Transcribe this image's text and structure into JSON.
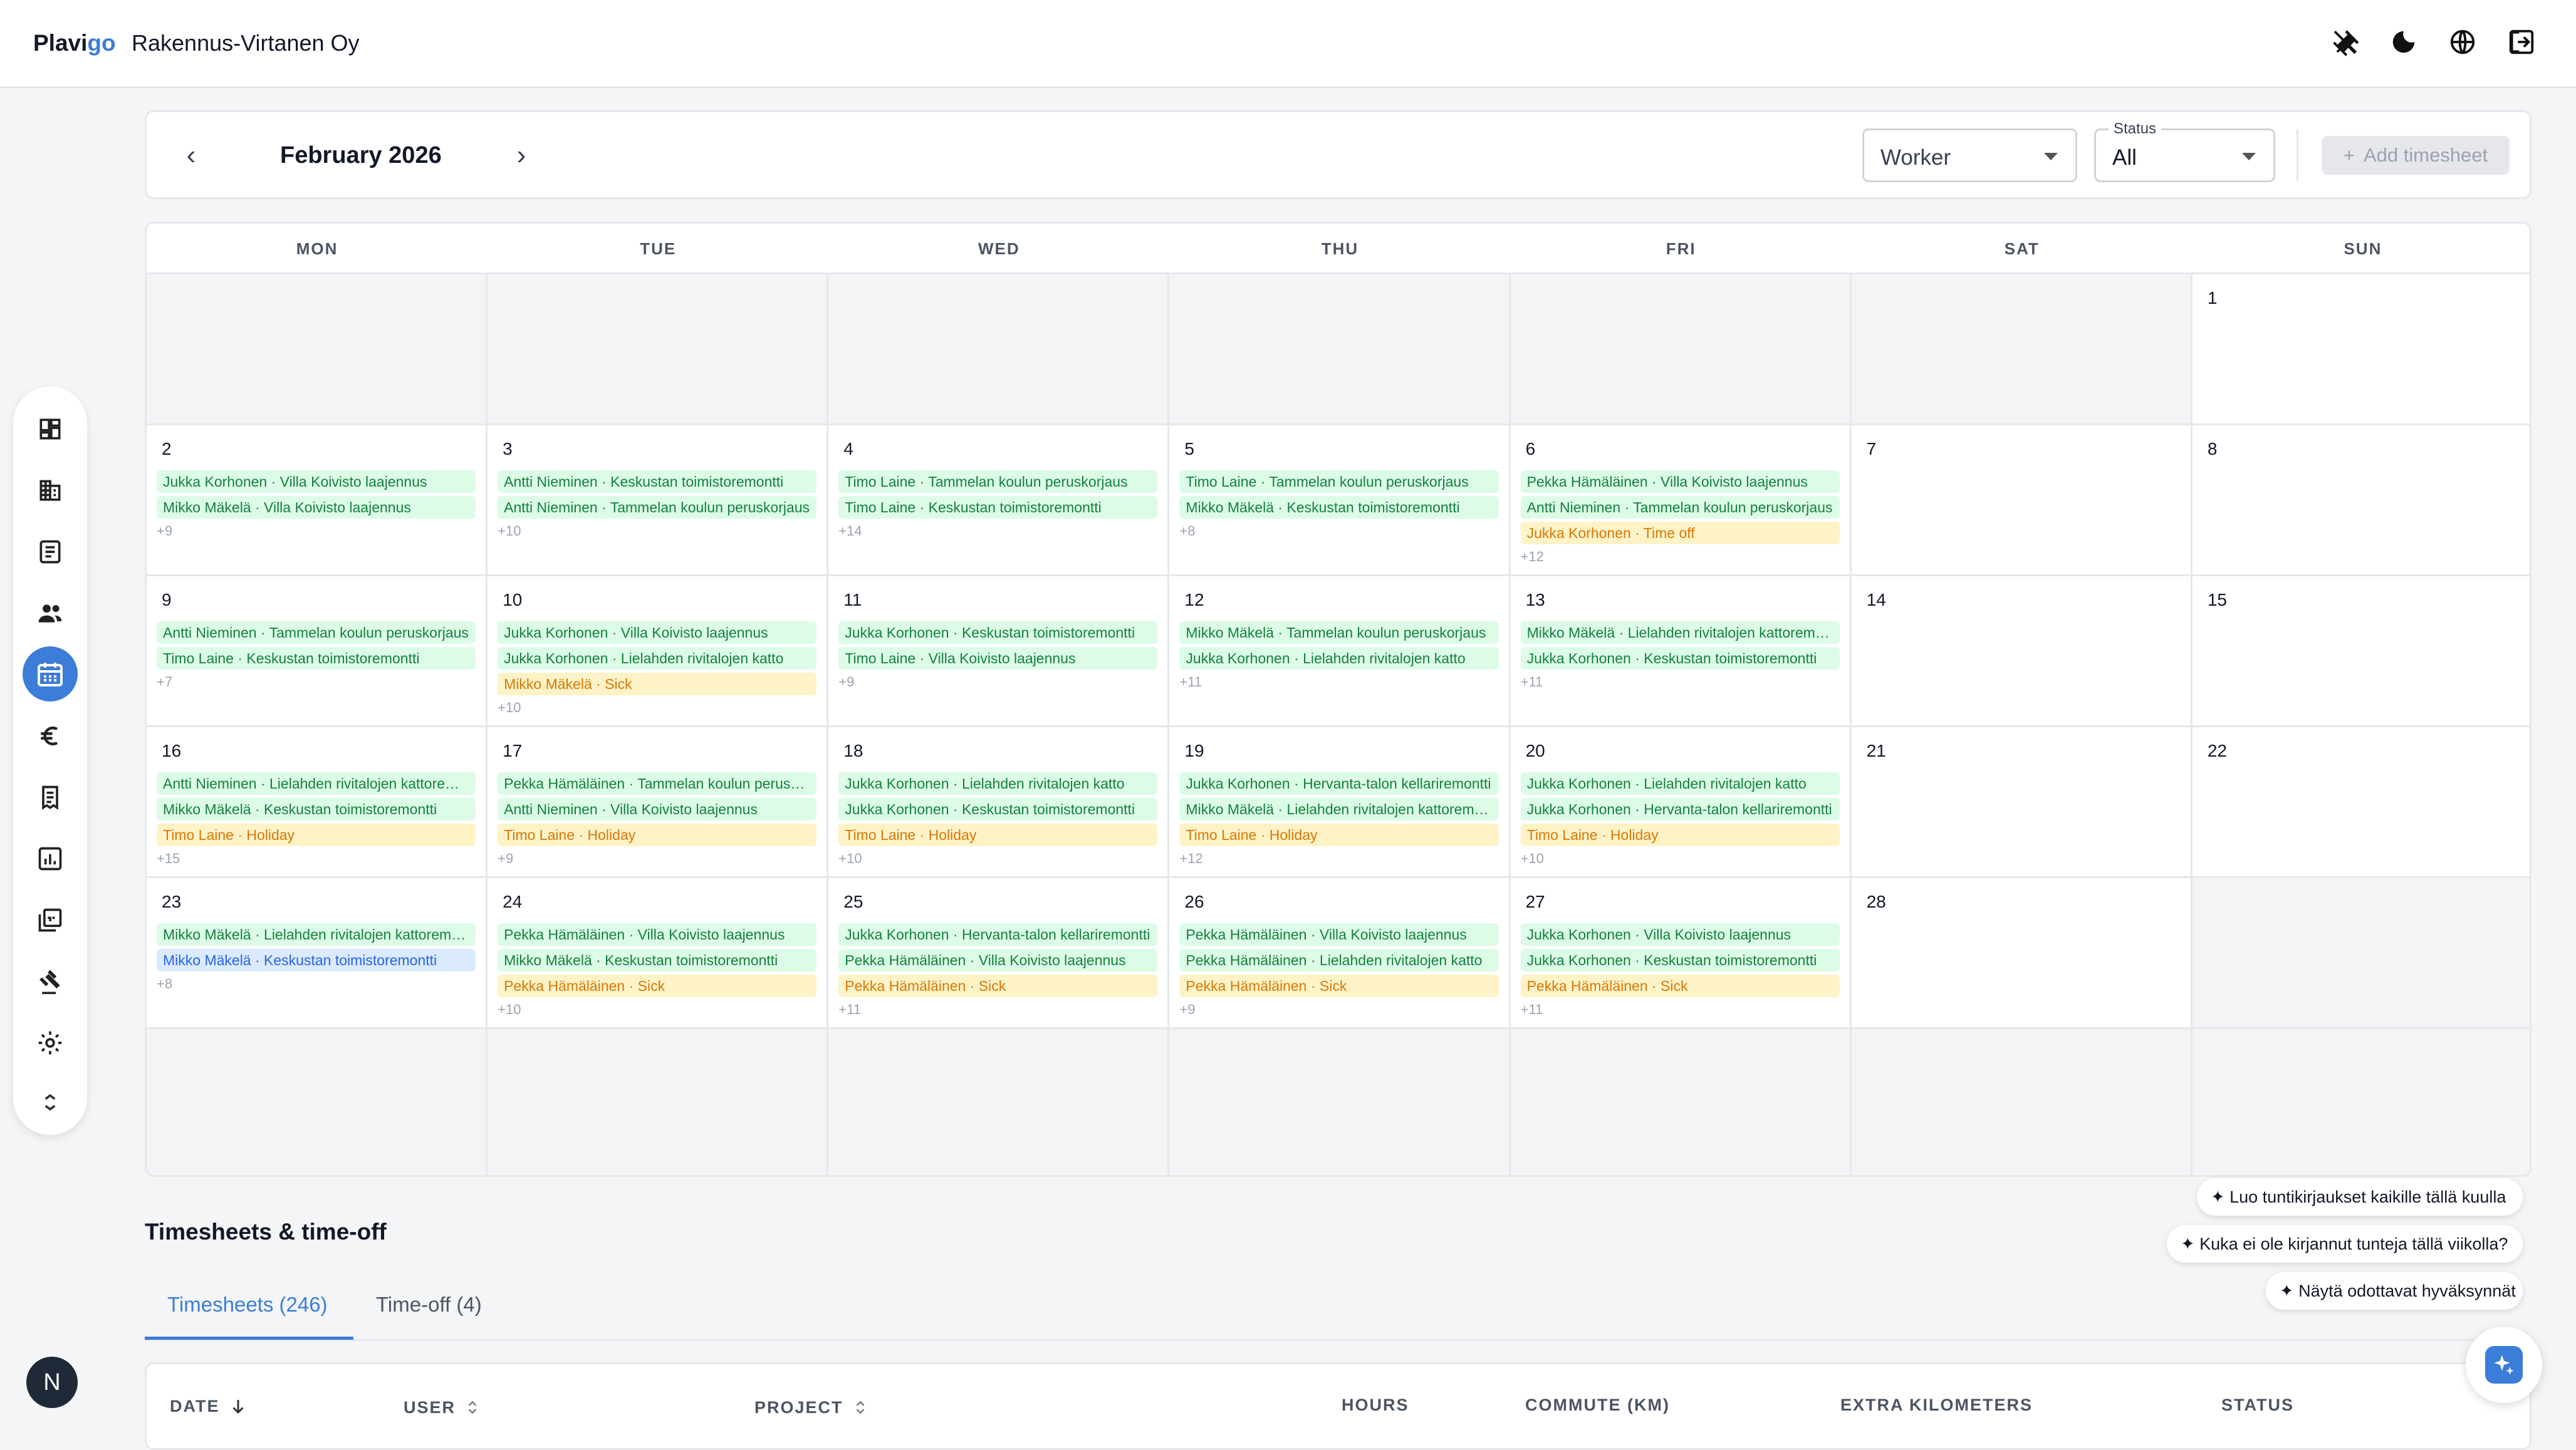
{
  "app": {
    "brand_main": "Plavi",
    "brand_accent": "go",
    "company": "Rakennus-Virtanen Oy",
    "accent_color": "#3b7dd8"
  },
  "top_icons": [
    "tools-icon",
    "dark-mode-icon",
    "language-globe-icon",
    "logout-icon"
  ],
  "sidebar": {
    "items": [
      {
        "icon": "dashboard-icon"
      },
      {
        "icon": "company-building-icon"
      },
      {
        "icon": "projects-document-icon"
      },
      {
        "icon": "users-icon"
      },
      {
        "icon": "calendar-icon",
        "active": true
      },
      {
        "icon": "euro-icon"
      },
      {
        "icon": "invoice-receipt-icon"
      },
      {
        "icon": "reports-chart-icon"
      },
      {
        "icon": "pdf-document-icon"
      },
      {
        "icon": "legal-gavel-icon"
      },
      {
        "icon": "settings-gear-icon"
      },
      {
        "icon": "collapse-chevrons-icon"
      }
    ],
    "avatar_initial": "N"
  },
  "calendar": {
    "prev_icon": "‹",
    "next_icon": "›",
    "month_label": "February 2026",
    "worker_filter": {
      "value": "Worker"
    },
    "status_filter": {
      "label": "Status",
      "value": "All"
    },
    "add_button": "Add timesheet",
    "add_icon": "+",
    "weekdays": [
      "MON",
      "TUE",
      "WED",
      "THU",
      "FRI",
      "SAT",
      "SUN"
    ],
    "weeks": [
      [
        {
          "day": "",
          "entries": [],
          "more": ""
        },
        {
          "day": "",
          "entries": [],
          "more": ""
        },
        {
          "day": "",
          "entries": [],
          "more": ""
        },
        {
          "day": "",
          "entries": [],
          "more": ""
        },
        {
          "day": "",
          "entries": [],
          "more": ""
        },
        {
          "day": "",
          "entries": [],
          "more": ""
        },
        {
          "day": "1",
          "entries": [],
          "more": ""
        }
      ],
      [
        {
          "day": "2",
          "entries": [
            {
              "text": "Jukka Korhonen · Villa Koivisto laajennus",
              "color": "green"
            },
            {
              "text": "Mikko Mäkelä · Villa Koivisto laajennus",
              "color": "green"
            }
          ],
          "more": "+9"
        },
        {
          "day": "3",
          "entries": [
            {
              "text": "Antti Nieminen · Keskustan toimistoremontti",
              "color": "green"
            },
            {
              "text": "Antti Nieminen · Tammelan koulun peruskorjaus",
              "color": "green"
            }
          ],
          "more": "+10"
        },
        {
          "day": "4",
          "entries": [
            {
              "text": "Timo Laine · Tammelan koulun peruskorjaus",
              "color": "green"
            },
            {
              "text": "Timo Laine · Keskustan toimistoremontti",
              "color": "green"
            }
          ],
          "more": "+14"
        },
        {
          "day": "5",
          "entries": [
            {
              "text": "Timo Laine · Tammelan koulun peruskorjaus",
              "color": "green"
            },
            {
              "text": "Mikko Mäkelä · Keskustan toimistoremontti",
              "color": "green"
            }
          ],
          "more": "+8"
        },
        {
          "day": "6",
          "entries": [
            {
              "text": "Pekka Hämäläinen · Villa Koivisto laajennus",
              "color": "green"
            },
            {
              "text": "Antti Nieminen · Tammelan koulun peruskorjaus",
              "color": "green"
            },
            {
              "text": "Jukka Korhonen · Time off",
              "color": "yellow"
            }
          ],
          "more": "+12"
        },
        {
          "day": "7",
          "entries": [],
          "more": ""
        },
        {
          "day": "8",
          "entries": [],
          "more": ""
        }
      ],
      [
        {
          "day": "9",
          "entries": [
            {
              "text": "Antti Nieminen · Tammelan koulun peruskorjaus",
              "color": "green"
            },
            {
              "text": "Timo Laine · Keskustan toimistoremontti",
              "color": "green"
            }
          ],
          "more": "+7"
        },
        {
          "day": "10",
          "entries": [
            {
              "text": "Jukka Korhonen · Villa Koivisto laajennus",
              "color": "green"
            },
            {
              "text": "Jukka Korhonen · Lielahden rivitalojen katto",
              "color": "green"
            },
            {
              "text": "Mikko Mäkelä · Sick",
              "color": "yellow"
            }
          ],
          "more": "+10"
        },
        {
          "day": "11",
          "entries": [
            {
              "text": "Jukka Korhonen · Keskustan toimistoremontti",
              "color": "green"
            },
            {
              "text": "Timo Laine · Villa Koivisto laajennus",
              "color": "green"
            }
          ],
          "more": "+9"
        },
        {
          "day": "12",
          "entries": [
            {
              "text": "Mikko Mäkelä · Tammelan koulun peruskorjaus",
              "color": "green"
            },
            {
              "text": "Jukka Korhonen · Lielahden rivitalojen katto",
              "color": "green"
            }
          ],
          "more": "+11"
        },
        {
          "day": "13",
          "entries": [
            {
              "text": "Mikko Mäkelä · Lielahden rivitalojen kattoremontti",
              "color": "green"
            },
            {
              "text": "Jukka Korhonen · Keskustan toimistoremontti",
              "color": "green"
            }
          ],
          "more": "+11"
        },
        {
          "day": "14",
          "entries": [],
          "more": ""
        },
        {
          "day": "15",
          "entries": [],
          "more": ""
        }
      ],
      [
        {
          "day": "16",
          "entries": [
            {
              "text": "Antti Nieminen · Lielahden rivitalojen kattoremontti",
              "color": "green"
            },
            {
              "text": "Mikko Mäkelä · Keskustan toimistoremontti",
              "color": "green"
            },
            {
              "text": "Timo Laine · Holiday",
              "color": "yellow"
            }
          ],
          "more": "+15"
        },
        {
          "day": "17",
          "entries": [
            {
              "text": "Pekka Hämäläinen · Tammelan koulun peruskorjaus",
              "color": "green"
            },
            {
              "text": "Antti Nieminen · Villa Koivisto laajennus",
              "color": "green"
            },
            {
              "text": "Timo Laine · Holiday",
              "color": "yellow"
            }
          ],
          "more": "+9"
        },
        {
          "day": "18",
          "entries": [
            {
              "text": "Jukka Korhonen · Lielahden rivitalojen katto",
              "color": "green"
            },
            {
              "text": "Jukka Korhonen · Keskustan toimistoremontti",
              "color": "green"
            },
            {
              "text": "Timo Laine · Holiday",
              "color": "yellow"
            }
          ],
          "more": "+10"
        },
        {
          "day": "19",
          "entries": [
            {
              "text": "Jukka Korhonen · Hervanta-talon kellariremontti",
              "color": "green"
            },
            {
              "text": "Mikko Mäkelä · Lielahden rivitalojen kattoremontti",
              "color": "green"
            },
            {
              "text": "Timo Laine · Holiday",
              "color": "yellow"
            }
          ],
          "more": "+12"
        },
        {
          "day": "20",
          "entries": [
            {
              "text": "Jukka Korhonen · Lielahden rivitalojen katto",
              "color": "green"
            },
            {
              "text": "Jukka Korhonen · Hervanta-talon kellariremontti",
              "color": "green"
            },
            {
              "text": "Timo Laine · Holiday",
              "color": "yellow"
            }
          ],
          "more": "+10"
        },
        {
          "day": "21",
          "entries": [],
          "more": ""
        },
        {
          "day": "22",
          "entries": [],
          "more": ""
        }
      ],
      [
        {
          "day": "23",
          "entries": [
            {
              "text": "Mikko Mäkelä · Lielahden rivitalojen kattoremontti",
              "color": "green"
            },
            {
              "text": "Mikko Mäkelä · Keskustan toimistoremontti",
              "color": "blue"
            }
          ],
          "more": "+8"
        },
        {
          "day": "24",
          "entries": [
            {
              "text": "Pekka Hämäläinen · Villa Koivisto laajennus",
              "color": "green"
            },
            {
              "text": "Mikko Mäkelä · Keskustan toimistoremontti",
              "color": "green"
            },
            {
              "text": "Pekka Hämäläinen · Sick",
              "color": "yellow"
            }
          ],
          "more": "+10"
        },
        {
          "day": "25",
          "entries": [
            {
              "text": "Jukka Korhonen · Hervanta-talon kellariremontti",
              "color": "green"
            },
            {
              "text": "Pekka Hämäläinen · Villa Koivisto laajennus",
              "color": "green"
            },
            {
              "text": "Pekka Hämäläinen · Sick",
              "color": "yellow"
            }
          ],
          "more": "+11"
        },
        {
          "day": "26",
          "entries": [
            {
              "text": "Pekka Hämäläinen · Villa Koivisto laajennus",
              "color": "green"
            },
            {
              "text": "Pekka Hämäläinen · Lielahden rivitalojen katto",
              "color": "green"
            },
            {
              "text": "Pekka Hämäläinen · Sick",
              "color": "yellow"
            }
          ],
          "more": "+9"
        },
        {
          "day": "27",
          "entries": [
            {
              "text": "Jukka Korhonen · Villa Koivisto laajennus",
              "color": "green"
            },
            {
              "text": "Jukka Korhonen · Keskustan toimistoremontti",
              "color": "green"
            },
            {
              "text": "Pekka Hämäläinen · Sick",
              "color": "yellow"
            }
          ],
          "more": "+11"
        },
        {
          "day": "28",
          "entries": [],
          "more": ""
        },
        {
          "day": "",
          "entries": [],
          "more": ""
        }
      ],
      [
        {
          "day": "",
          "entries": [],
          "more": ""
        },
        {
          "day": "",
          "entries": [],
          "more": ""
        },
        {
          "day": "",
          "entries": [],
          "more": ""
        },
        {
          "day": "",
          "entries": [],
          "more": ""
        },
        {
          "day": "",
          "entries": [],
          "more": ""
        },
        {
          "day": "",
          "entries": [],
          "more": ""
        },
        {
          "day": "",
          "entries": [],
          "more": ""
        }
      ]
    ]
  },
  "section": {
    "title": "Timesheets & time-off",
    "tabs": [
      {
        "label": "Timesheets (246)",
        "active": true
      },
      {
        "label": "Time-off (4)",
        "active": false
      }
    ]
  },
  "table": {
    "columns": [
      {
        "label": "DATE",
        "sort": "down-arrow-icon"
      },
      {
        "label": "USER",
        "sort": "sort-updown-icon"
      },
      {
        "label": "PROJECT",
        "sort": "sort-updown-icon"
      },
      {
        "label": "HOURS",
        "sort": ""
      },
      {
        "label": "COMMUTE (KM)",
        "sort": ""
      },
      {
        "label": "EXTRA KILOMETERS",
        "sort": ""
      },
      {
        "label": "STATUS",
        "sort": ""
      }
    ]
  },
  "assistant": {
    "suggestions": [
      "✦ Luo tuntikirjaukset kaikille tällä kuulla",
      "✦ Kuka ei ole kirjannut tunteja tällä viikolla?",
      "✦ Näytä odottavat hyväksynnät"
    ],
    "button_icon": "ai-sparkle-icon"
  }
}
